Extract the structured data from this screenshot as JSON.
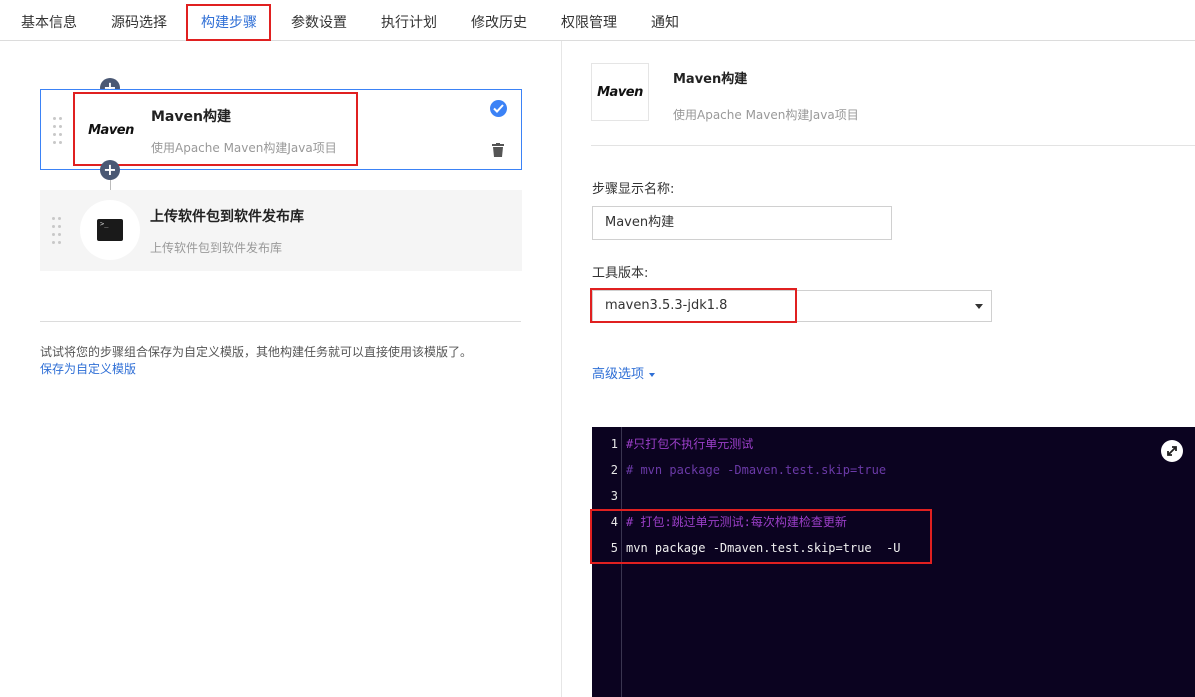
{
  "tabs": [
    {
      "label": "基本信息"
    },
    {
      "label": "源码选择"
    },
    {
      "label": "构建步骤"
    },
    {
      "label": "参数设置"
    },
    {
      "label": "执行计划"
    },
    {
      "label": "修改历史"
    },
    {
      "label": "权限管理"
    },
    {
      "label": "通知"
    }
  ],
  "active_tab": "构建步骤",
  "steps": [
    {
      "title": "Maven构建",
      "desc": "使用Apache Maven构建Java项目",
      "logo": "Maven",
      "selected": true
    },
    {
      "title": "上传软件包到软件发布库",
      "desc": "上传软件包到软件发布库",
      "icon": "terminal-icon",
      "selected": false
    }
  ],
  "tip": "试试将您的步骤组合保存为自定义模版，其他构建任务就可以直接使用该模版了。",
  "save_link": "保存为自定义模版",
  "detail": {
    "logo": "Maven",
    "title": "Maven构建",
    "desc": "使用Apache Maven构建Java项目",
    "name_label": "步骤显示名称:",
    "name_value": "Maven构建",
    "tool_label": "工具版本:",
    "tool_value": "maven3.5.3-jdk1.8",
    "advanced": "高级选项"
  },
  "code_lines": [
    {
      "n": "1",
      "text": "#只打包不执行单元测试",
      "kind": "comment-zh"
    },
    {
      "n": "2",
      "text": "# mvn package -Dmaven.test.skip=true",
      "kind": "comment"
    },
    {
      "n": "3",
      "text": "",
      "kind": "code"
    },
    {
      "n": "4",
      "text": "# 打包:跳过单元测试:每次构建检查更新",
      "kind": "comment-zh"
    },
    {
      "n": "5",
      "text": "mvn package -Dmaven.test.skip=true  -U",
      "kind": "code"
    }
  ],
  "colors": {
    "accent": "#2f6fd6",
    "highlight": "#e02020",
    "editor_bg": "#0b0320"
  }
}
